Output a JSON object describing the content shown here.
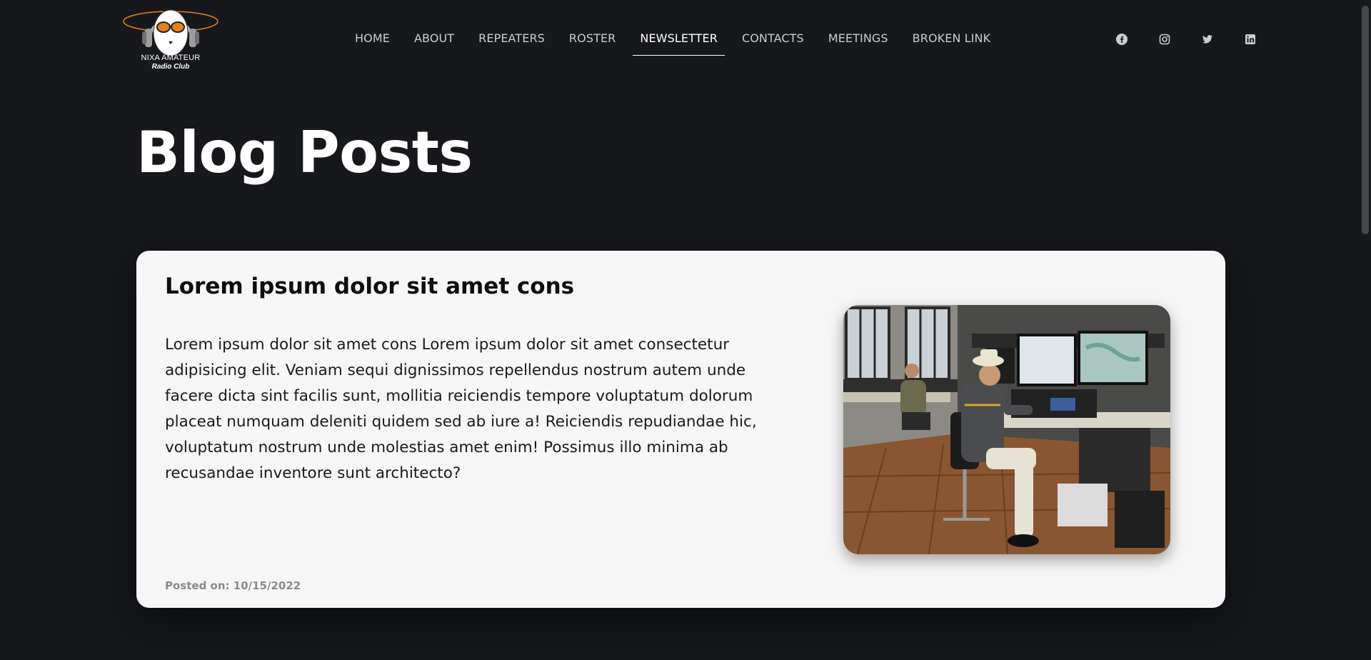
{
  "site": {
    "logo_line1": "NIXA AMATEUR",
    "logo_line2": "Radio Club"
  },
  "nav": {
    "items": [
      {
        "label": "HOME"
      },
      {
        "label": "ABOUT"
      },
      {
        "label": "REPEATERS"
      },
      {
        "label": "ROSTER"
      },
      {
        "label": "NEWSLETTER",
        "active": true
      },
      {
        "label": "CONTACTS"
      },
      {
        "label": "MEETINGS"
      },
      {
        "label": "BROKEN LINK"
      }
    ]
  },
  "social": [
    "facebook-icon",
    "instagram-icon",
    "twitter-icon",
    "linkedin-icon"
  ],
  "page": {
    "title": "Blog Posts"
  },
  "post": {
    "title": "Lorem ipsum dolor sit amet cons",
    "body": "Lorem ipsum dolor sit amet cons Lorem ipsum dolor sit amet consectetur adipisicing elit. Veniam sequi dignissimos repellendus nostrum autem unde facere dicta sint facilis sunt, mollitia reiciendis tempore voluptatum dolorum placeat numquam deleniti quidem sed ab iure a! Reiciendis repudiandae hic, voluptatum nostrum unde molestias amet enim! Possimus illo minima ab recusandae inventore sunt architecto?",
    "meta": "Posted on: 10/15/2022"
  },
  "colors": {
    "background": "#16181c",
    "card": "#f6f6f6",
    "nav_text": "#c9ccd1",
    "accent_orange": "#e8801e"
  }
}
